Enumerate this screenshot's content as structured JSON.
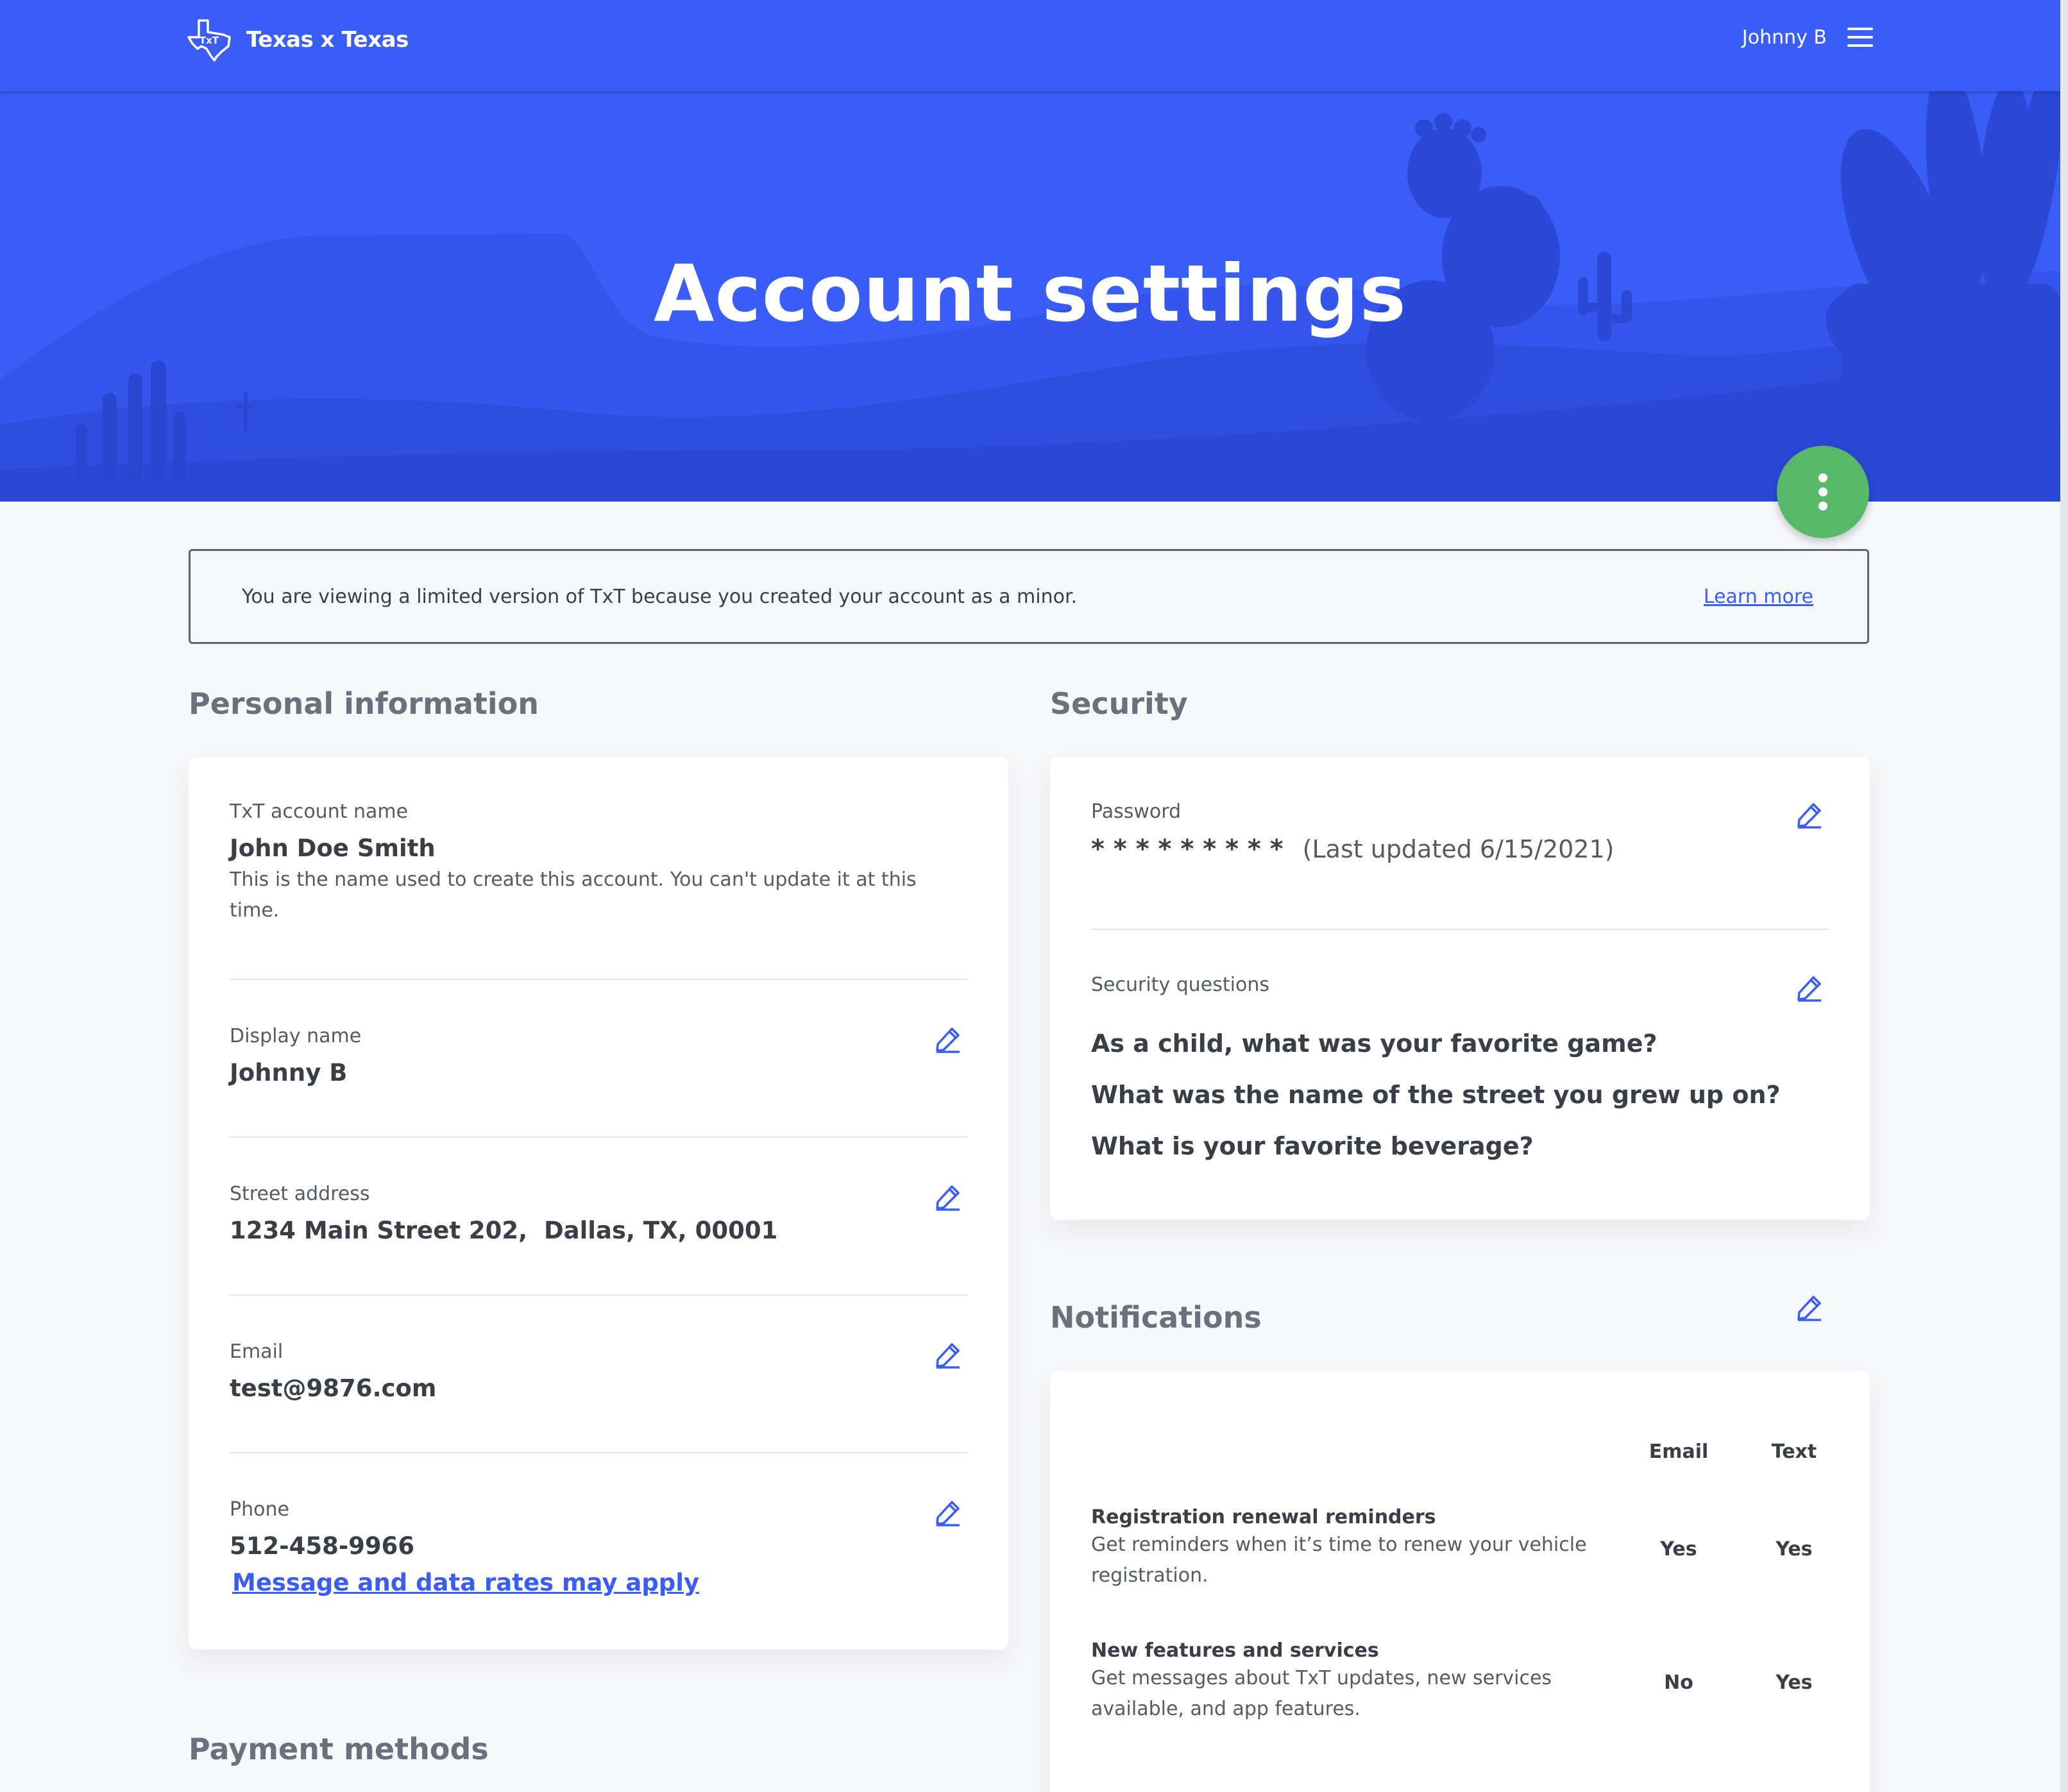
{
  "header": {
    "brand": "Texas x Texas",
    "user_name": "Johnny B"
  },
  "hero": {
    "title": "Account settings"
  },
  "banner": {
    "text": "You are viewing a limited version of TxT because you created your account as a minor.",
    "link": "Learn more"
  },
  "personal": {
    "title": "Personal information",
    "account_name": {
      "label": "TxT account name",
      "value": "John Doe Smith",
      "help": "This is the name used to create this account. You can't update it at this time."
    },
    "display_name": {
      "label": "Display name",
      "value": "Johnny B"
    },
    "street_address": {
      "label": "Street address",
      "value": "1234 Main Street 202,  Dallas, TX, 00001"
    },
    "email": {
      "label": "Email",
      "value": "test@9876.com"
    },
    "phone": {
      "label": "Phone",
      "value": "512-458-9966",
      "link": "Message and data rates may apply"
    }
  },
  "payment": {
    "title": "Payment methods"
  },
  "security": {
    "title": "Security",
    "password": {
      "label": "Password",
      "masked": "* * * * * * * * *",
      "updated": "(Last updated 6/15/2021)"
    },
    "questions": {
      "label": "Security questions",
      "items": [
        "As a child, what was your favorite game?",
        "What was the name of the street you grew up on?",
        "What is your favorite beverage?"
      ]
    }
  },
  "notifications": {
    "title": "Notifications",
    "columns": [
      "Email",
      "Text"
    ],
    "rows": [
      {
        "title": "Registration renewal reminders",
        "description": "Get reminders when it’s time to renew your vehicle registration.",
        "email": "Yes",
        "text": "Yes"
      },
      {
        "title": "New features and services",
        "description": "Get messages about TxT updates, new services available, and app features.",
        "email": "No",
        "text": "Yes"
      }
    ]
  },
  "colors": {
    "brand_blue": "#3a5df7",
    "fab_green": "#56b868",
    "text_dark": "#3a3f47"
  }
}
